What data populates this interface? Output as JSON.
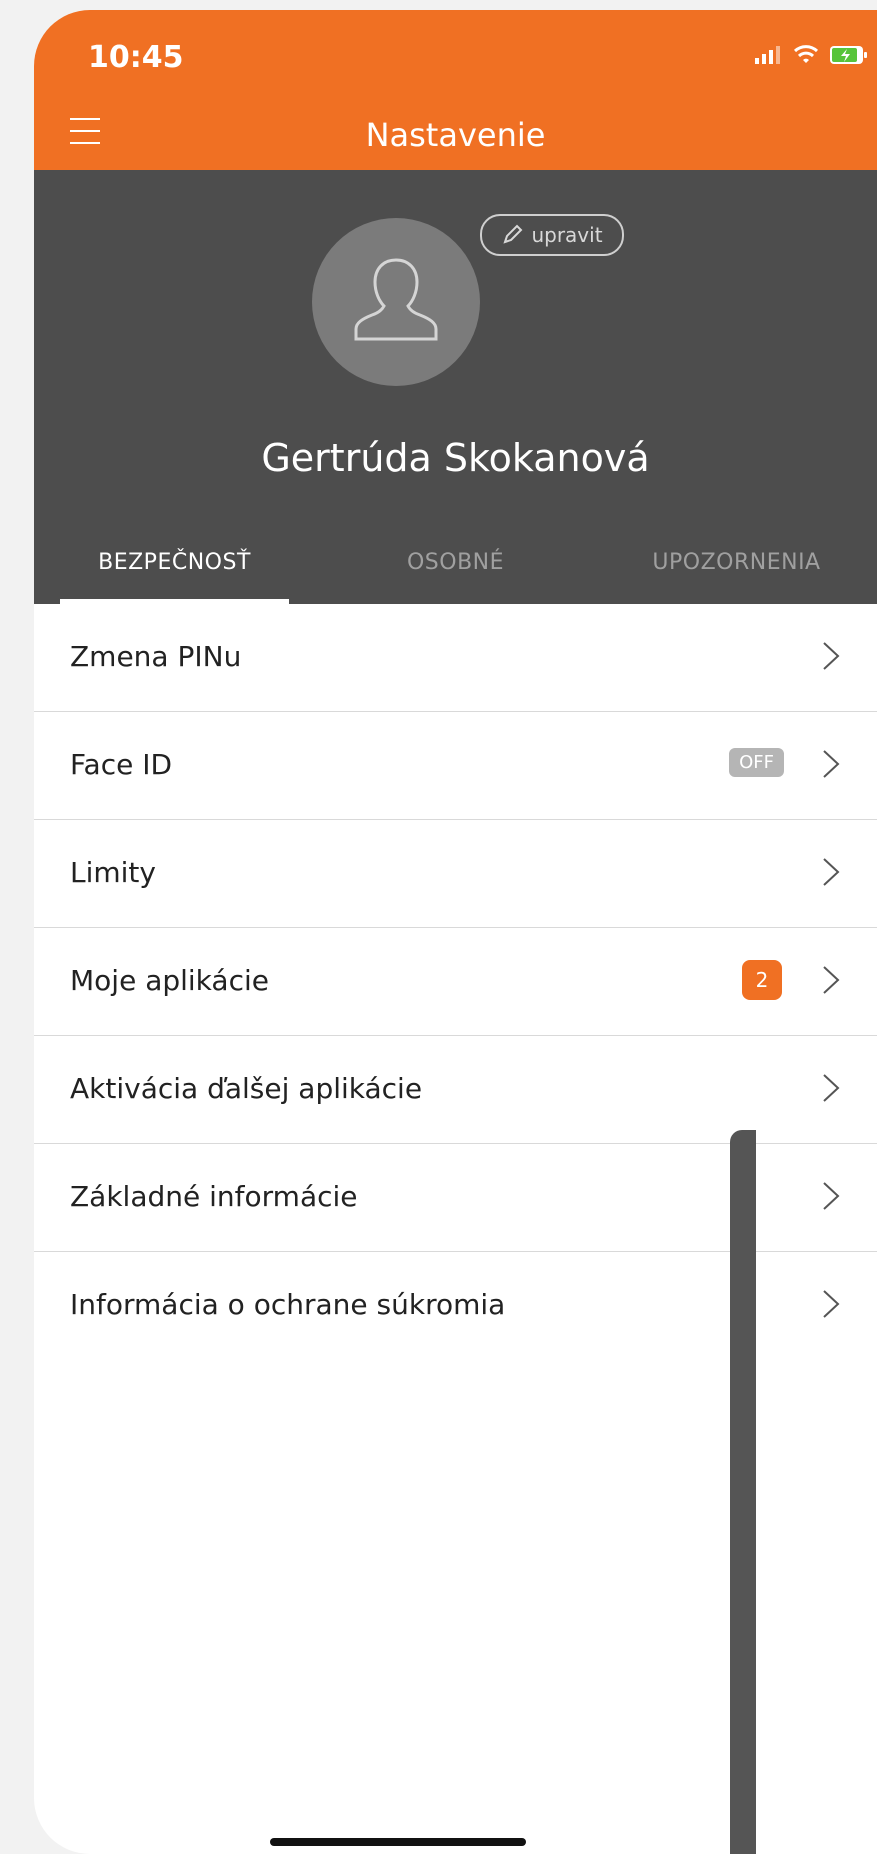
{
  "status": {
    "time": "10:45"
  },
  "header": {
    "title": "Nastavenie"
  },
  "profile": {
    "edit_label": "upravit",
    "name": "Gertrúda Skokanová"
  },
  "tabs": [
    {
      "label": "BEZPEČNOSŤ",
      "active": true
    },
    {
      "label": "OSOBNÉ",
      "active": false
    },
    {
      "label": "UPOZORNENIA",
      "active": false
    }
  ],
  "menu": [
    {
      "label": "Zmena PINu"
    },
    {
      "label": "Face ID",
      "badge": "OFF"
    },
    {
      "label": "Limity"
    },
    {
      "label": "Moje aplikácie",
      "count": "2"
    },
    {
      "label": "Aktivácia ďalšej aplikácie"
    },
    {
      "label": "Základné informácie"
    },
    {
      "label": "Informácia o ochrane súkromia"
    }
  ],
  "colors": {
    "accent": "#f07023",
    "profile_bg": "#4d4d4d"
  }
}
